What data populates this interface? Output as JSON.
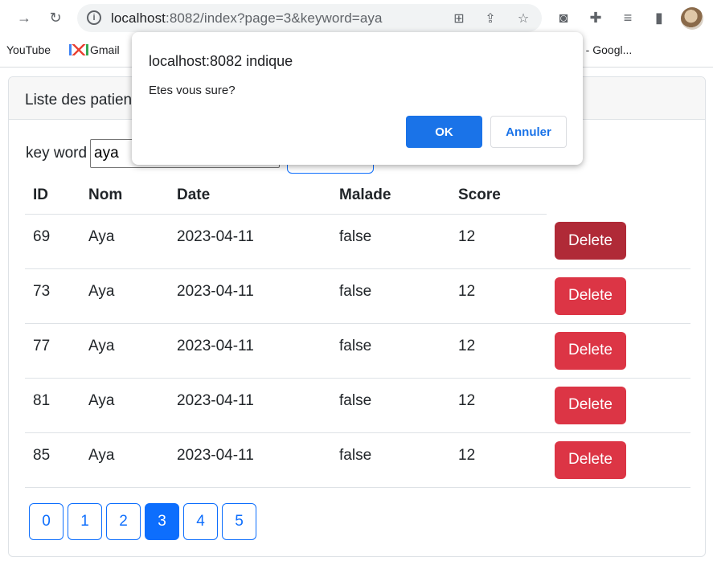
{
  "browser": {
    "url_host": "localhost",
    "url_rest": ":8082/index?page=3&keyword=aya",
    "bookmarks": [
      "YouTube",
      "Gmail",
      "e - Googl..."
    ]
  },
  "card": {
    "header": "Liste des patients",
    "search_label": "key word",
    "search_value": "aya"
  },
  "table": {
    "headers": [
      "ID",
      "Nom",
      "Date",
      "Malade",
      "Score"
    ],
    "rows": [
      {
        "id": "69",
        "nom": "Aya",
        "date": "2023-04-11",
        "malade": "false",
        "score": "12"
      },
      {
        "id": "73",
        "nom": "Aya",
        "date": "2023-04-11",
        "malade": "false",
        "score": "12"
      },
      {
        "id": "77",
        "nom": "Aya",
        "date": "2023-04-11",
        "malade": "false",
        "score": "12"
      },
      {
        "id": "81",
        "nom": "Aya",
        "date": "2023-04-11",
        "malade": "false",
        "score": "12"
      },
      {
        "id": "85",
        "nom": "Aya",
        "date": "2023-04-11",
        "malade": "false",
        "score": "12"
      }
    ],
    "delete_label": "Delete"
  },
  "pagination": {
    "pages": [
      "0",
      "1",
      "2",
      "3",
      "4",
      "5"
    ],
    "active": "3"
  },
  "dialog": {
    "title": "localhost:8082 indique",
    "message": "Etes vous sure?",
    "ok_label": "OK",
    "cancel_label": "Annuler"
  },
  "colors": {
    "primary": "#0d6efd",
    "danger": "#dc3545",
    "danger_hover": "#b02a37",
    "dialog_primary": "#1a73e8"
  }
}
